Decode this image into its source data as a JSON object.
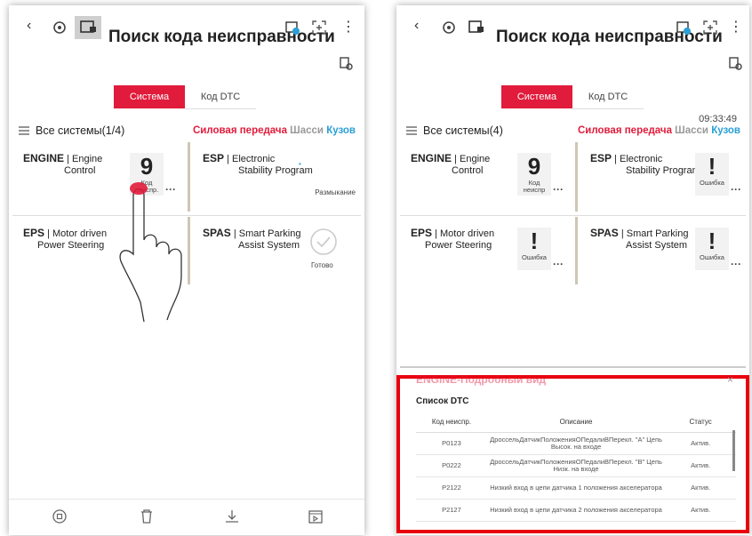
{
  "left": {
    "title": "Поиск кода неисправности",
    "tab_system": "Система",
    "tab_dtc": "Код DTC",
    "all_systems": "Все системы(1/4)",
    "filter_power": "Силовая передача",
    "filter_chassis": "Шасси",
    "filter_body": "Кузов",
    "cards": [
      {
        "bold": "ENGINE",
        "name1": "Engine",
        "name2": "Control",
        "count": "9",
        "status": "Код неиспр."
      },
      {
        "bold": "ESP",
        "name1": "Electronic",
        "name2": "Stability Program",
        "status": "Размыкание"
      },
      {
        "bold": "EPS",
        "name1": "Motor driven",
        "name2": "Power Steering"
      },
      {
        "bold": "SPAS",
        "name1": "Smart Parking",
        "name2": "Assist System",
        "status": "Готово"
      }
    ]
  },
  "right": {
    "title": "Поиск кода неисправности",
    "tab_system": "Система",
    "tab_dtc": "Код DTC",
    "time": "09:33:49",
    "all_systems": "Все системы(4)",
    "filter_power": "Силовая передача",
    "filter_chassis": "Шасси",
    "filter_body": "Кузов",
    "cards": [
      {
        "bold": "ENGINE",
        "name1": "Engine",
        "name2": "Control",
        "count": "9",
        "status": "Код неиспр"
      },
      {
        "bold": "ESP",
        "name1": "Electronic",
        "name2": "Stability Program",
        "count": "!",
        "status": "Ошибка"
      },
      {
        "bold": "EPS",
        "name1": "Motor driven",
        "name2": "Power Steering",
        "count": "!",
        "status": "Ошибка"
      },
      {
        "bold": "SPAS",
        "name1": "Smart Parking",
        "name2": "Assist System",
        "count": "!",
        "status": "Ошибка"
      }
    ]
  },
  "detail": {
    "title": "ENGINE-Подробный вид",
    "list_title": "Список DTC",
    "headers": [
      "Код неиспр.",
      "Описание",
      "Статус"
    ],
    "rows": [
      {
        "code": "P0123",
        "desc": "ДроссельДатчикПоложенияОПедалиВПерекл. \"A\" Цепь Высок. на входе",
        "status": "Актив."
      },
      {
        "code": "P0222",
        "desc": "ДроссельДатчикПоложенияОПедалиВПерекл. \"B\" Цепь Низк. на входе",
        "status": "Актив."
      },
      {
        "code": "P2122",
        "desc": "Низкий вход в цепи датчика 1 положения акселератора",
        "status": "Актив."
      },
      {
        "code": "P2127",
        "desc": "Низкий вход в цепи датчика 2 положения акселератора",
        "status": "Актив."
      }
    ]
  },
  "colors": {
    "accent": "#e11b3b",
    "body": "#2a9fd6",
    "highlight": "#e8000e"
  }
}
